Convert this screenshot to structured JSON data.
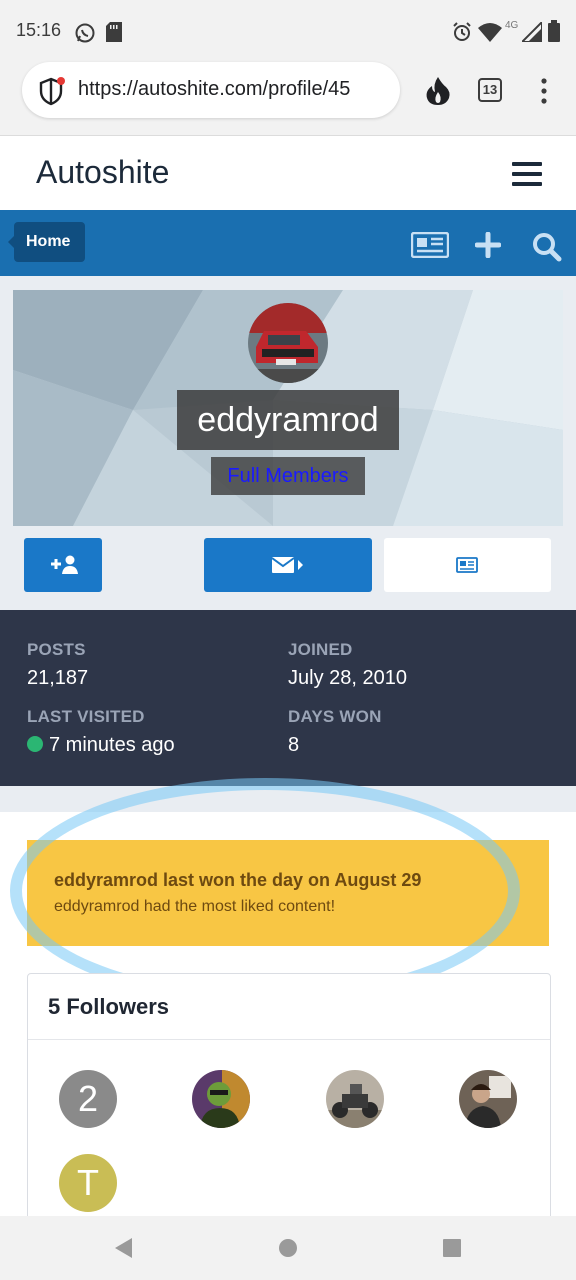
{
  "status_bar": {
    "time": "15:16",
    "network_label": "4G",
    "icons": [
      "whatsapp-icon",
      "sim-card-icon",
      "alarm-icon",
      "wifi-icon",
      "signal-icon",
      "battery-icon"
    ]
  },
  "browser": {
    "url": "https://autoshite.com/profile/45",
    "tab_count": "13",
    "icons": [
      "shield-icon",
      "flame-icon",
      "tabs-icon",
      "overflow-menu-icon"
    ]
  },
  "site": {
    "brand": "Autoshite",
    "nav_home": "Home",
    "nav_icons": [
      "newspaper-icon",
      "plus-icon",
      "search-icon"
    ]
  },
  "profile": {
    "username": "eddyramrod",
    "group": "Full Members",
    "buttons": [
      "follow-button",
      "message-button",
      "content-button"
    ]
  },
  "stats": {
    "posts_label": "Posts",
    "posts_value": "21,187",
    "joined_label": "Joined",
    "joined_value": "July 28, 2010",
    "last_visited_label": "Last Visited",
    "last_visited_value": "7 minutes ago",
    "days_won_label": "Days Won",
    "days_won_value": "8"
  },
  "days_won_notice": {
    "title": "eddyramrod last won the day on August 29",
    "subtitle": "eddyramrod had the most liked content!"
  },
  "followers": {
    "title": "5 Followers",
    "items": [
      {
        "letter": "2",
        "color": "#8a8a8a"
      },
      {
        "letter": "",
        "color": "#6d9c3a"
      },
      {
        "letter": "",
        "color": "#8a8070"
      },
      {
        "letter": "",
        "color": "#6e6256"
      },
      {
        "letter": "T",
        "color": "#c9bd55"
      }
    ]
  },
  "colors": {
    "nav_blue": "#1a6fb0",
    "button_blue": "#1a78c8",
    "stats_bg": "#2e3649",
    "notice_yellow": "#f8c644",
    "online_green": "#2bb673"
  }
}
